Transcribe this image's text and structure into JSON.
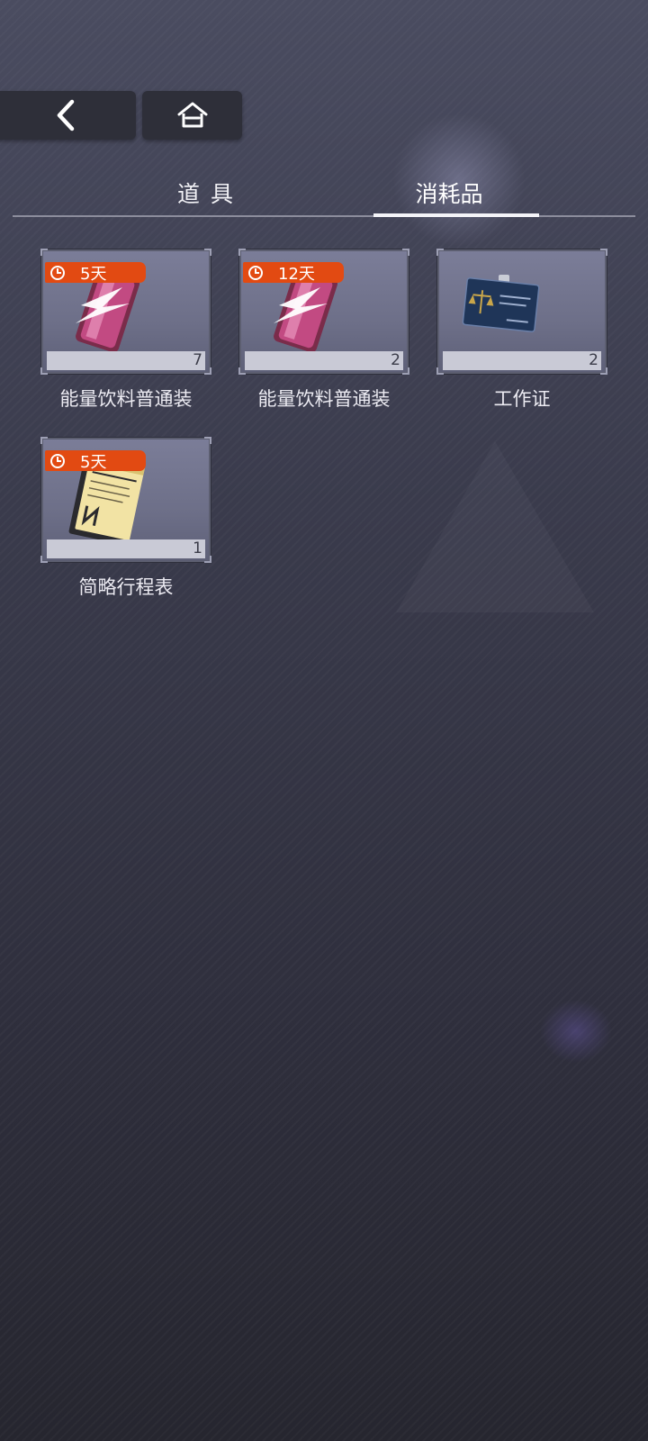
{
  "nav": {
    "back_icon": "chevron-left-icon",
    "home_icon": "home-icon"
  },
  "tabs": [
    {
      "label": "道具",
      "active": false
    },
    {
      "label": "消耗品",
      "active": true
    }
  ],
  "items": [
    {
      "name": "能量饮料普通装",
      "count": "7",
      "timer": "5天",
      "icon": "energy-drink-icon"
    },
    {
      "name": "能量饮料普通装",
      "count": "2",
      "timer": "12天",
      "icon": "energy-drink-icon"
    },
    {
      "name": "工作证",
      "count": "2",
      "timer": "",
      "icon": "id-badge-icon"
    },
    {
      "name": "简略行程表",
      "count": "1",
      "timer": "5天",
      "icon": "schedule-booklet-icon"
    }
  ],
  "colors": {
    "timer_badge": "#e24a12",
    "tab_active": "#f4f4f8"
  }
}
